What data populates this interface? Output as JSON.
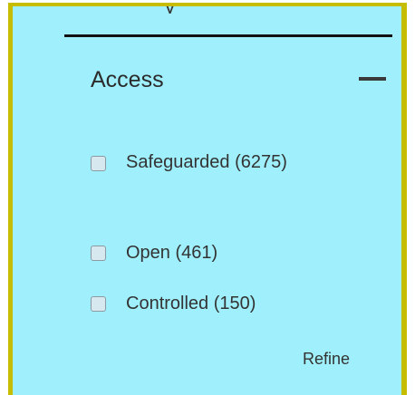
{
  "facet": {
    "title": "Access",
    "previous_heading_fragment": "y",
    "collapse_icon": "minus-icon",
    "options": [
      {
        "label": "Safeguarded",
        "count": "(6275)",
        "text": "Safeguarded (6275)",
        "checked": false
      },
      {
        "label": "Open",
        "count": "(461)",
        "text": "Open (461)",
        "checked": false
      },
      {
        "label": "Controlled",
        "count": "(150)",
        "text": "Controlled (150)",
        "checked": false
      }
    ],
    "refine_label": "Refine"
  },
  "colors": {
    "panel_background": "#9ff0fc",
    "panel_border": "#c6bc00",
    "divider": "#111111",
    "text": "#333333"
  }
}
